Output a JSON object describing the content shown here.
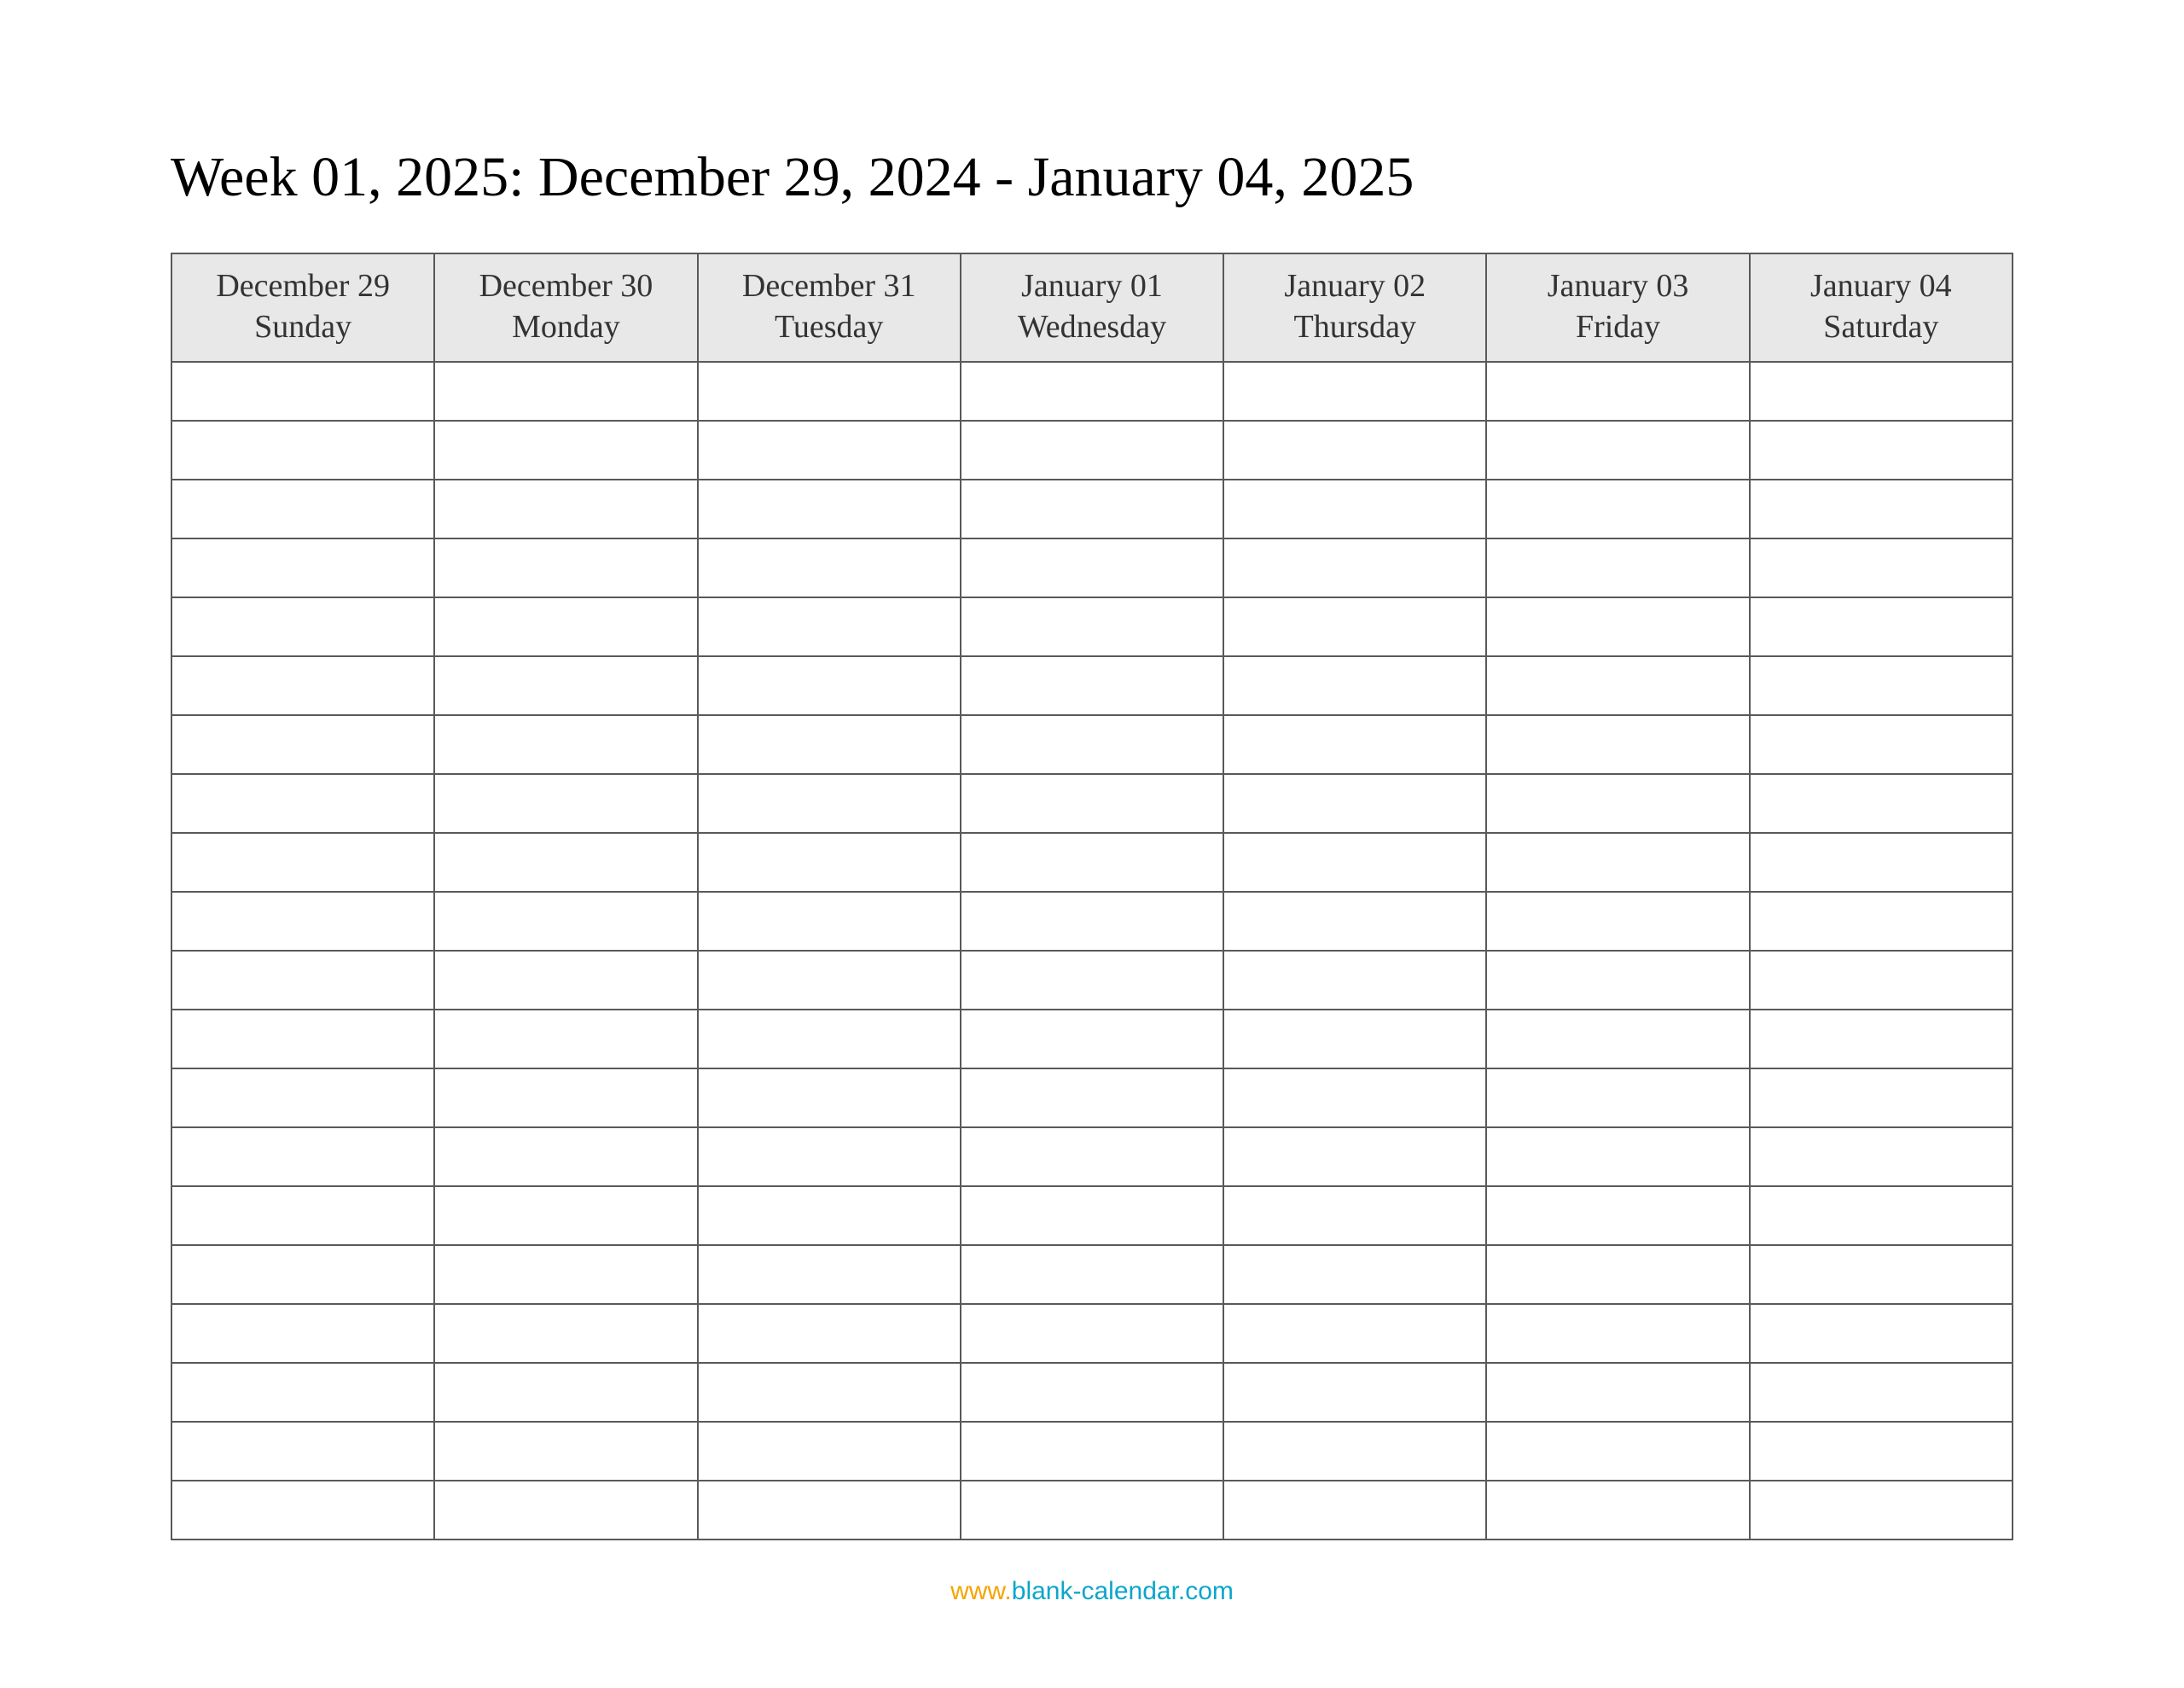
{
  "title": "Week 01, 2025: December 29, 2024 - January 04, 2025",
  "columns": [
    {
      "date": "December 29",
      "day": "Sunday"
    },
    {
      "date": "December 30",
      "day": "Monday"
    },
    {
      "date": "December 31",
      "day": "Tuesday"
    },
    {
      "date": "January 01",
      "day": "Wednesday"
    },
    {
      "date": "January 02",
      "day": "Thursday"
    },
    {
      "date": "January 03",
      "day": "Friday"
    },
    {
      "date": "January 04",
      "day": "Saturday"
    }
  ],
  "rows": 20,
  "footer": {
    "www": "www.",
    "domain": "blank-calendar.com"
  }
}
